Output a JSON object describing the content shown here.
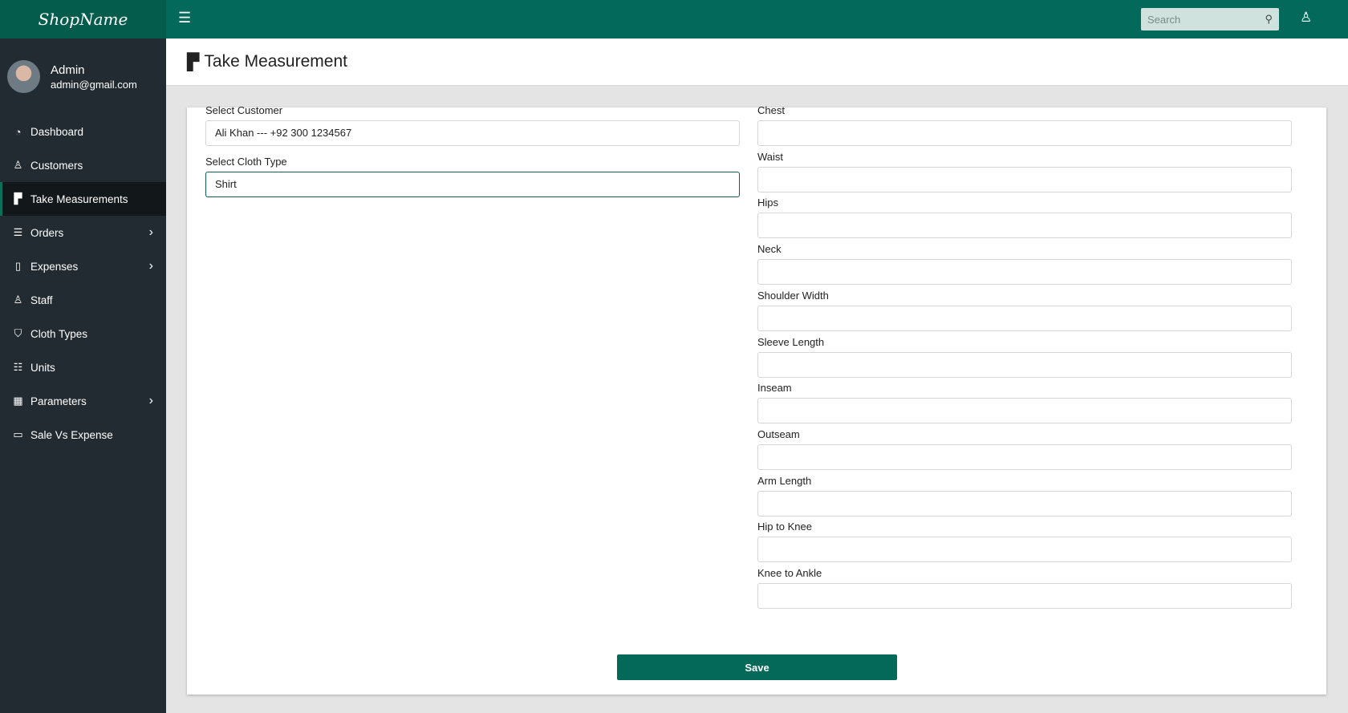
{
  "brand": "ShopName",
  "user": {
    "name": "Admin",
    "email": "admin@gmail.com"
  },
  "nav": [
    {
      "label": "Dashboard",
      "icon": "dashboard-icon",
      "glyph": "◔"
    },
    {
      "label": "Customers",
      "icon": "user-icon",
      "glyph": "♙"
    },
    {
      "label": "Take Measurements",
      "icon": "ruler-icon",
      "glyph": "▛"
    },
    {
      "label": "Orders",
      "icon": "checklist-icon",
      "glyph": "☰",
      "chevron": true
    },
    {
      "label": "Expenses",
      "icon": "file-icon",
      "glyph": "▯",
      "chevron": true
    },
    {
      "label": "Staff",
      "icon": "user-icon",
      "glyph": "♙"
    },
    {
      "label": "Cloth Types",
      "icon": "bag-icon",
      "glyph": "⛉"
    },
    {
      "label": "Units",
      "icon": "units-icon",
      "glyph": "☷"
    },
    {
      "label": "Parameters",
      "icon": "table-icon",
      "glyph": "▦",
      "chevron": true
    },
    {
      "label": "Sale Vs Expense",
      "icon": "window-icon",
      "glyph": "▭"
    }
  ],
  "search": {
    "placeholder": "Search"
  },
  "page_title": "Take Measurement",
  "form": {
    "customer": {
      "label": "Select Customer",
      "value": "Ali Khan --- +92 300 1234567"
    },
    "cloth_type": {
      "label": "Select Cloth Type",
      "value": "Shirt"
    },
    "measurements": [
      "Chest",
      "Waist",
      "Hips",
      "Neck",
      "Shoulder Width",
      "Sleeve Length",
      "Inseam",
      "Outseam",
      "Arm Length",
      "Hip to Knee",
      "Knee to Ankle"
    ],
    "save_label": "Save"
  }
}
